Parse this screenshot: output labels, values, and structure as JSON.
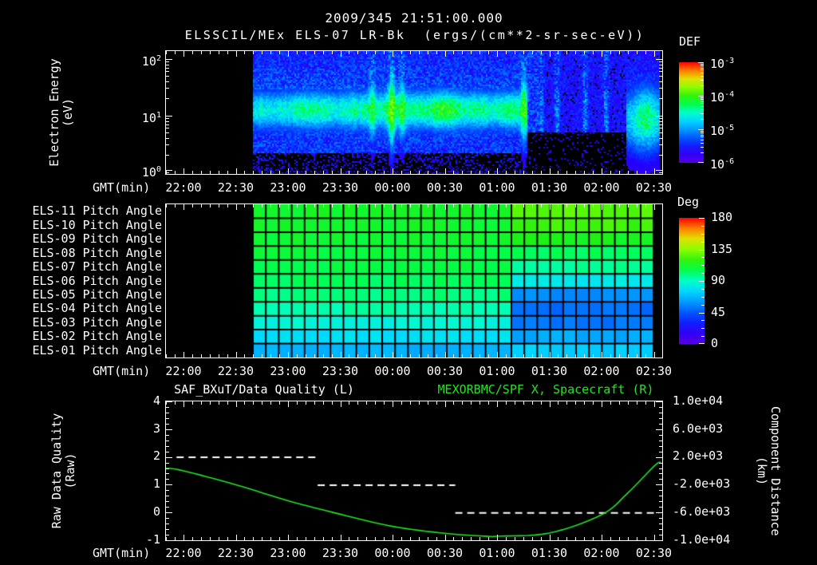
{
  "title": {
    "line1": "2009/345 21:51:00.000",
    "line2": "ELSSCIL/MEx ELS-07 LR-Bk  (ergs/(cm**2-sr-sec-eV))"
  },
  "colors": {
    "background": "#000000",
    "axis": "#ffffff",
    "text": "#ffffff",
    "accent_green": "#22e522"
  },
  "time_axis": {
    "label": "GMT(min)",
    "ticks": [
      "22:00",
      "22:30",
      "23:00",
      "23:30",
      "00:00",
      "00:30",
      "01:00",
      "01:30",
      "02:00",
      "02:30"
    ]
  },
  "energy_panel": {
    "ylabel": "Electron Energy",
    "ylabel_unit": "(eV)",
    "ytick_base": "10",
    "ytick_exponents": [
      "2",
      "1",
      "0"
    ]
  },
  "def_colorbar": {
    "title": "DEF",
    "tick_base": "10",
    "tick_exponents": [
      "-3",
      "-4",
      "-5",
      "-6"
    ]
  },
  "deg_colorbar": {
    "title": "Deg",
    "ticks": [
      "180",
      "135",
      "90",
      "45",
      "0"
    ]
  },
  "pitch_panel": {
    "row_labels": [
      "ELS-11 Pitch Angle",
      "ELS-10 Pitch Angle",
      "ELS-09 Pitch Angle",
      "ELS-08 Pitch Angle",
      "ELS-07 Pitch Angle",
      "ELS-06 Pitch Angle",
      "ELS-05 Pitch Angle",
      "ELS-04 Pitch Angle",
      "ELS-03 Pitch Angle",
      "ELS-02 Pitch Angle",
      "ELS-01 Pitch Angle"
    ]
  },
  "quality_panel": {
    "title_left": "SAF_BXuT/Data Quality (L)",
    "title_right": "MEXORBMC/SPF X, Spacecraft (R)",
    "ylabel_left": "Raw Data Quality",
    "ylabel_left_unit": "(Raw)",
    "yticks_left": [
      "4",
      "3",
      "2",
      "1",
      "0",
      "-1"
    ],
    "ylabel_right": "Component Distance",
    "ylabel_right_unit": "(km)",
    "yticks_right": [
      "1.0e+04",
      "6.0e+03",
      "2.0e+03",
      "-2.0e+03",
      "-6.0e+03",
      "-1.0e+04"
    ]
  },
  "chart_data": [
    {
      "type": "heatmap",
      "title": "ELSSCIL/MEx ELS-07 LR-Bk electron energy spectrogram",
      "xlabel": "GMT(min)",
      "ylabel": "Electron Energy (eV)",
      "x_range": [
        "21:50",
        "02:34"
      ],
      "y_range_eV": [
        1,
        147
      ],
      "y_scale": "log",
      "colorbar": {
        "label": "DEF",
        "units": "ergs/(cm**2-sr-sec-eV)",
        "range": [
          1e-06,
          0.001
        ],
        "scale": "log"
      },
      "no_data_before": "22:40",
      "features": {
        "main_band": {
          "t0": "22:40",
          "t1": "01:17",
          "center_eV": 13,
          "sigma_decades": 0.26,
          "peak_def": 0.00012
        },
        "upper_speckle_def": 4e-06,
        "lower_speckle_def": 3e-06,
        "bright_streaks": [
          "23:48",
          "23:59",
          "00:05"
        ],
        "band_edge_streak": "01:15",
        "quiet_interval": {
          "t0": "01:17",
          "t1": "02:14",
          "faint_streaks": [
            "01:25",
            "01:34",
            "01:50",
            "02:02"
          ]
        },
        "closing_blob": {
          "t0": "02:14",
          "t1": "02:33",
          "center_eV": 9,
          "sigma_decades": 0.42,
          "peak_def": 0.0001
        }
      }
    },
    {
      "type": "heatmap",
      "title": "ELS pitch angles by anode",
      "xlabel": "GMT(min)",
      "colorbar": {
        "label": "Deg",
        "range": [
          0,
          180
        ]
      },
      "rows": [
        "ELS-11",
        "ELS-10",
        "ELS-09",
        "ELS-08",
        "ELS-07",
        "ELS-06",
        "ELS-05",
        "ELS-04",
        "ELS-03",
        "ELS-02",
        "ELS-01"
      ],
      "no_data_before": "22:40",
      "data_end": "02:30",
      "segments": [
        {
          "t0": "22:40",
          "t1": "01:06",
          "pitch_deg": [
            112,
            111,
            110,
            108,
            106,
            103,
            99,
            94,
            86,
            78,
            66
          ]
        },
        {
          "t0": "01:06",
          "t1": "02:30",
          "pitch_deg": [
            126,
            122,
            114,
            103,
            96,
            82,
            57,
            50,
            52,
            64,
            73
          ]
        }
      ],
      "grid": "black cell grid, roughly 9 min per cell"
    },
    {
      "type": "line",
      "title_left": "SAF_BXuT/Data Quality (L)",
      "title_right": "MEXORBMC/SPF X, Spacecraft (R)",
      "x_range": [
        "21:50",
        "02:34"
      ],
      "left_axis": {
        "label": "Raw Data Quality (Raw)",
        "range": [
          -1,
          4
        ]
      },
      "right_axis": {
        "label": "Component Distance (km)",
        "range": [
          -10000,
          10000
        ]
      },
      "series": [
        {
          "name": "SAF_BXuT/Data Quality",
          "axis": "left",
          "style": "dashed white steps",
          "steps": [
            {
              "value": 2,
              "from": "21:56",
              "to": "23:17"
            },
            {
              "value": 1,
              "from": "23:17",
              "to": "00:36"
            },
            {
              "value": 0,
              "from": "00:36",
              "to": "02:33"
            }
          ]
        },
        {
          "name": "MEXORBMC/SPF X Spacecraft",
          "axis": "right",
          "style": "solid green curve",
          "color": "#22e522",
          "points": [
            [
              "21:50",
              400
            ],
            [
              "22:00",
              0
            ],
            [
              "22:30",
              -2000
            ],
            [
              "23:00",
              -4300
            ],
            [
              "23:30",
              -6250
            ],
            [
              "00:00",
              -8000
            ],
            [
              "00:30",
              -9000
            ],
            [
              "00:55",
              -9440
            ],
            [
              "01:00",
              -9420
            ],
            [
              "01:30",
              -8960
            ],
            [
              "02:00",
              -6320
            ],
            [
              "02:15",
              -3200
            ],
            [
              "02:30",
              640
            ],
            [
              "02:34",
              1280
            ]
          ]
        }
      ]
    }
  ]
}
